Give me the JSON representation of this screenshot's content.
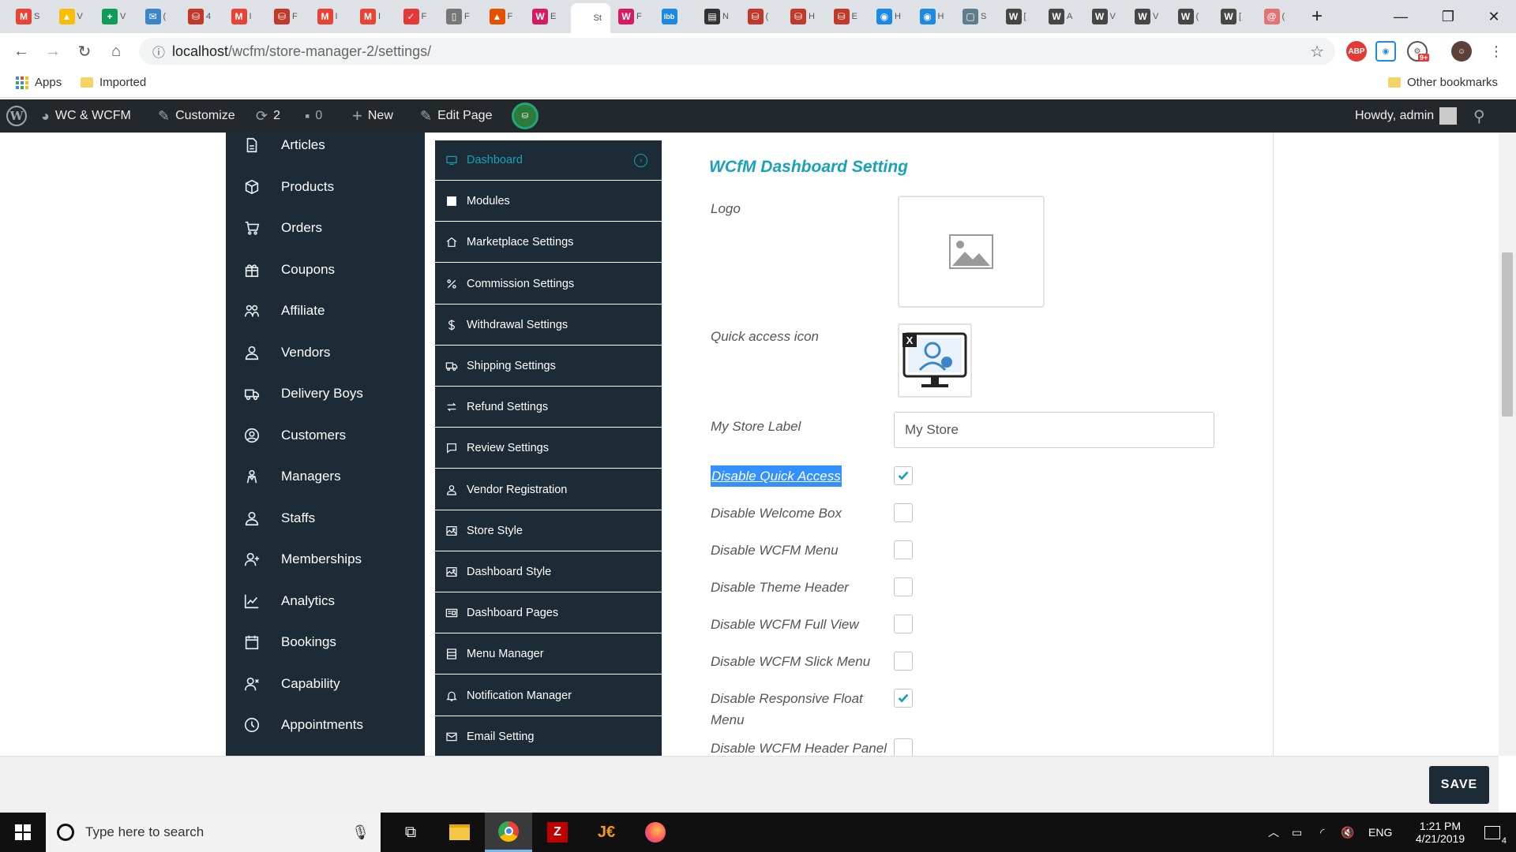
{
  "browser": {
    "tabs": [
      {
        "icon": "gmail-icon",
        "letter": "M",
        "color": "#ea4335",
        "label": "S"
      },
      {
        "icon": "drive-icon",
        "letter": "▲",
        "color": "#fbbc05",
        "label": "V"
      },
      {
        "icon": "sheets-icon",
        "letter": "+",
        "color": "#0f9d58",
        "label": "V"
      },
      {
        "icon": "mail-icon",
        "letter": "✉",
        "color": "#3d85c6",
        "label": "("
      },
      {
        "icon": "wcfm-icon",
        "letter": "⛁",
        "color": "#c0392b",
        "label": "4"
      },
      {
        "icon": "gmail-icon",
        "letter": "M",
        "color": "#ea4335",
        "label": "I"
      },
      {
        "icon": "wcfm-icon",
        "letter": "⛁",
        "color": "#c0392b",
        "label": "F"
      },
      {
        "icon": "gmail-icon",
        "letter": "M",
        "color": "#ea4335",
        "label": "I"
      },
      {
        "icon": "gmail-icon",
        "letter": "M",
        "color": "#ea4335",
        "label": "I"
      },
      {
        "icon": "pdf-icon",
        "letter": "✓",
        "color": "#e53935",
        "label": "F"
      },
      {
        "icon": "doc-icon",
        "letter": "▯",
        "color": "#777777",
        "label": "F"
      },
      {
        "icon": "blog-icon",
        "letter": "▲",
        "color": "#e65100",
        "label": "F"
      },
      {
        "icon": "w-icon",
        "letter": "W",
        "color": "#d81b60",
        "label": "E"
      },
      {
        "icon": "active-tab-icon",
        "letter": "",
        "color": "#ffffff",
        "label": "St",
        "active": true
      },
      {
        "icon": "w-icon",
        "letter": "W",
        "color": "#d81b60",
        "label": "F"
      },
      {
        "icon": "ibb-icon",
        "letter": "ibb",
        "color": "#1e88e5",
        "label": ""
      },
      {
        "icon": "film-icon",
        "letter": "▤",
        "color": "#333333",
        "label": "N"
      },
      {
        "icon": "wcfm-icon",
        "letter": "⛁",
        "color": "#c0392b",
        "label": "("
      },
      {
        "icon": "wcfm-icon",
        "letter": "⛁",
        "color": "#c0392b",
        "label": "H"
      },
      {
        "icon": "wcfm-icon",
        "letter": "⛁",
        "color": "#c0392b",
        "label": "E"
      },
      {
        "icon": "globe-icon",
        "letter": "◉",
        "color": "#1e88e5",
        "label": "H"
      },
      {
        "icon": "globe-icon",
        "letter": "◉",
        "color": "#1e88e5",
        "label": "H"
      },
      {
        "icon": "screen-icon",
        "letter": "▢",
        "color": "#607d8b",
        "label": "S"
      },
      {
        "icon": "wordpress-icon",
        "letter": "W",
        "color": "#464646",
        "label": "["
      },
      {
        "icon": "wordpress-icon",
        "letter": "W",
        "color": "#464646",
        "label": "A"
      },
      {
        "icon": "wordpress-icon",
        "letter": "W",
        "color": "#464646",
        "label": "V"
      },
      {
        "icon": "wordpress-icon",
        "letter": "W",
        "color": "#464646",
        "label": "V"
      },
      {
        "icon": "wordpress-icon",
        "letter": "W",
        "color": "#464646",
        "label": "("
      },
      {
        "icon": "wordpress-icon",
        "letter": "W",
        "color": "#464646",
        "label": "["
      },
      {
        "icon": "swirl-icon",
        "letter": "@",
        "color": "#e57373",
        "label": "("
      }
    ],
    "url_host": "localhost",
    "url_path": "/wcfm/store-manager-2/settings/",
    "bookmarks": {
      "apps": "Apps",
      "imported": "Imported",
      "other": "Other bookmarks"
    },
    "extensions": {
      "abp": "ABP",
      "badge": "9+"
    }
  },
  "adminbar": {
    "site": "WC & WCFM",
    "customize": "Customize",
    "updates_count": "2",
    "comments_count": "0",
    "new": "New",
    "edit_page": "Edit Page",
    "howdy": "Howdy, admin"
  },
  "leftmenu": [
    {
      "label": "Articles",
      "icon": "articles-icon"
    },
    {
      "label": "Products",
      "icon": "products-icon"
    },
    {
      "label": "Orders",
      "icon": "orders-icon"
    },
    {
      "label": "Coupons",
      "icon": "coupons-icon"
    },
    {
      "label": "Affiliate",
      "icon": "affiliate-icon"
    },
    {
      "label": "Vendors",
      "icon": "vendors-icon"
    },
    {
      "label": "Delivery Boys",
      "icon": "delivery-boys-icon"
    },
    {
      "label": "Customers",
      "icon": "customers-icon"
    },
    {
      "label": "Managers",
      "icon": "managers-icon"
    },
    {
      "label": "Staffs",
      "icon": "staffs-icon"
    },
    {
      "label": "Memberships",
      "icon": "memberships-icon"
    },
    {
      "label": "Analytics",
      "icon": "analytics-icon"
    },
    {
      "label": "Bookings",
      "icon": "bookings-icon"
    },
    {
      "label": "Capability",
      "icon": "capability-icon"
    },
    {
      "label": "Appointments",
      "icon": "appointments-icon"
    }
  ],
  "settings_nav": [
    {
      "label": "Dashboard",
      "icon": "dashboard-icon",
      "active": true
    },
    {
      "label": "Modules",
      "icon": "modules-icon"
    },
    {
      "label": "Marketplace Settings",
      "icon": "marketplace-icon"
    },
    {
      "label": "Commission Settings",
      "icon": "percent-icon"
    },
    {
      "label": "Withdrawal Settings",
      "icon": "dollar-icon"
    },
    {
      "label": "Shipping Settings",
      "icon": "shipping-icon"
    },
    {
      "label": "Refund Settings",
      "icon": "refund-icon"
    },
    {
      "label": "Review Settings",
      "icon": "review-icon"
    },
    {
      "label": "Vendor Registration",
      "icon": "vendor-registration-icon"
    },
    {
      "label": "Store Style",
      "icon": "store-style-icon"
    },
    {
      "label": "Dashboard Style",
      "icon": "dashboard-style-icon"
    },
    {
      "label": "Dashboard Pages",
      "icon": "dashboard-pages-icon"
    },
    {
      "label": "Menu Manager",
      "icon": "menu-manager-icon"
    },
    {
      "label": "Notification Manager",
      "icon": "bell-icon"
    },
    {
      "label": "Email Setting",
      "icon": "email-icon"
    }
  ],
  "panel": {
    "title": "WCfM Dashboard Setting",
    "logo_label": "Logo",
    "quick_access_label": "Quick access icon",
    "quick_access_remove": "X",
    "store_label_label": "My Store Label",
    "store_label_value": "My Store",
    "checkboxes": [
      {
        "label": "Disable Quick Access",
        "checked": true,
        "selected": true
      },
      {
        "label": "Disable Welcome Box",
        "checked": false
      },
      {
        "label": "Disable WCFM Menu",
        "checked": false
      },
      {
        "label": "Disable Theme Header",
        "checked": false
      },
      {
        "label": "Disable WCFM Full View",
        "checked": false
      },
      {
        "label": "Disable WCFM Slick Menu",
        "checked": false
      },
      {
        "label": "Disable Responsive Float Menu",
        "checked": true,
        "multiline": true
      },
      {
        "label": "Disable WCFM Header Panel",
        "checked": false
      }
    ]
  },
  "save_button": "SAVE",
  "taskbar": {
    "search_placeholder": "Type here to search",
    "language": "ENG",
    "time": "1:21 PM",
    "date": "4/21/2019",
    "notifications": "4"
  }
}
